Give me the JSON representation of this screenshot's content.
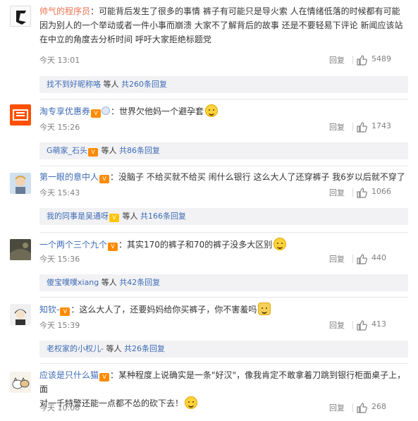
{
  "comments": [
    {
      "username": "帅气的程序员",
      "separator": "：",
      "text_line1": "可能背后发生了很多的事情 裤子有可能只是导火索 人在情绪低落的时候都有可能",
      "text_line2": "因为别人的一个举动或者一件小事而崩溃 大家不了解背后的故事 还是不要轻易下评论 新闻应该站",
      "text_line3": "在中立的角度去分析时间 呼吁大家拒绝标题党",
      "time": "今天 13:01",
      "reply_label": "回复",
      "likes": "5489",
      "sub_user": "找不到好昵称咯",
      "sub_mid": " 等人 ",
      "sub_count": "共260条回复"
    },
    {
      "username": "淘专享优惠券",
      "separator": "：",
      "text_line1": "世界欠他妈一个避孕套",
      "time": "今天 15:26",
      "reply_label": "回复",
      "likes": "1743",
      "sub_user": "G萌家_石头",
      "sub_mid": " 等人 ",
      "sub_count": "共86条回复"
    },
    {
      "username": "第一眼的意中人",
      "separator": "：",
      "text_line1": "没脑子 不给买就不给买 闹什么银行 这么大人了还穿裤子 我6岁以后就不穿了",
      "time": "今天 15:43",
      "reply_label": "回复",
      "likes": "1066",
      "sub_user": "我的同事是吴通呀",
      "sub_mid": " 等人 ",
      "sub_count": "共166条回复"
    },
    {
      "username": "一个两个三个九个",
      "separator": "：",
      "text_line1": "其实170的裤子和70的裤子没多大区别",
      "time": "今天 15:36",
      "reply_label": "回复",
      "likes": "440",
      "sub_user": "傻宝噗噗xiang",
      "sub_mid": " 等人 ",
      "sub_count": "共42条回复"
    },
    {
      "username": "知钦-",
      "separator": "：",
      "text_line1": "这么大人了，还要妈妈给你买裤子，你不害羞吗",
      "time": "今天 15:39",
      "reply_label": "回复",
      "likes": "413",
      "sub_user": "老权家的小权儿-",
      "sub_mid": " 等人 ",
      "sub_count": "共26条回复"
    },
    {
      "username": "应该是只什么猫",
      "separator": "：",
      "text_line1": "某种程度上说确实是一条\"好汉\"，像我肯定不敢拿着刀跳到银行柜面桌子上，面",
      "text_line2": "对一千特警还能一点都不怂的砍下去！",
      "time": "今天 10:08",
      "reply_label": "回复",
      "likes": "268"
    }
  ],
  "colors": {
    "username": "#eb7350",
    "link": "#3d6bb5",
    "meta": "#808080",
    "subbox_bg": "#f2f2f5"
  }
}
